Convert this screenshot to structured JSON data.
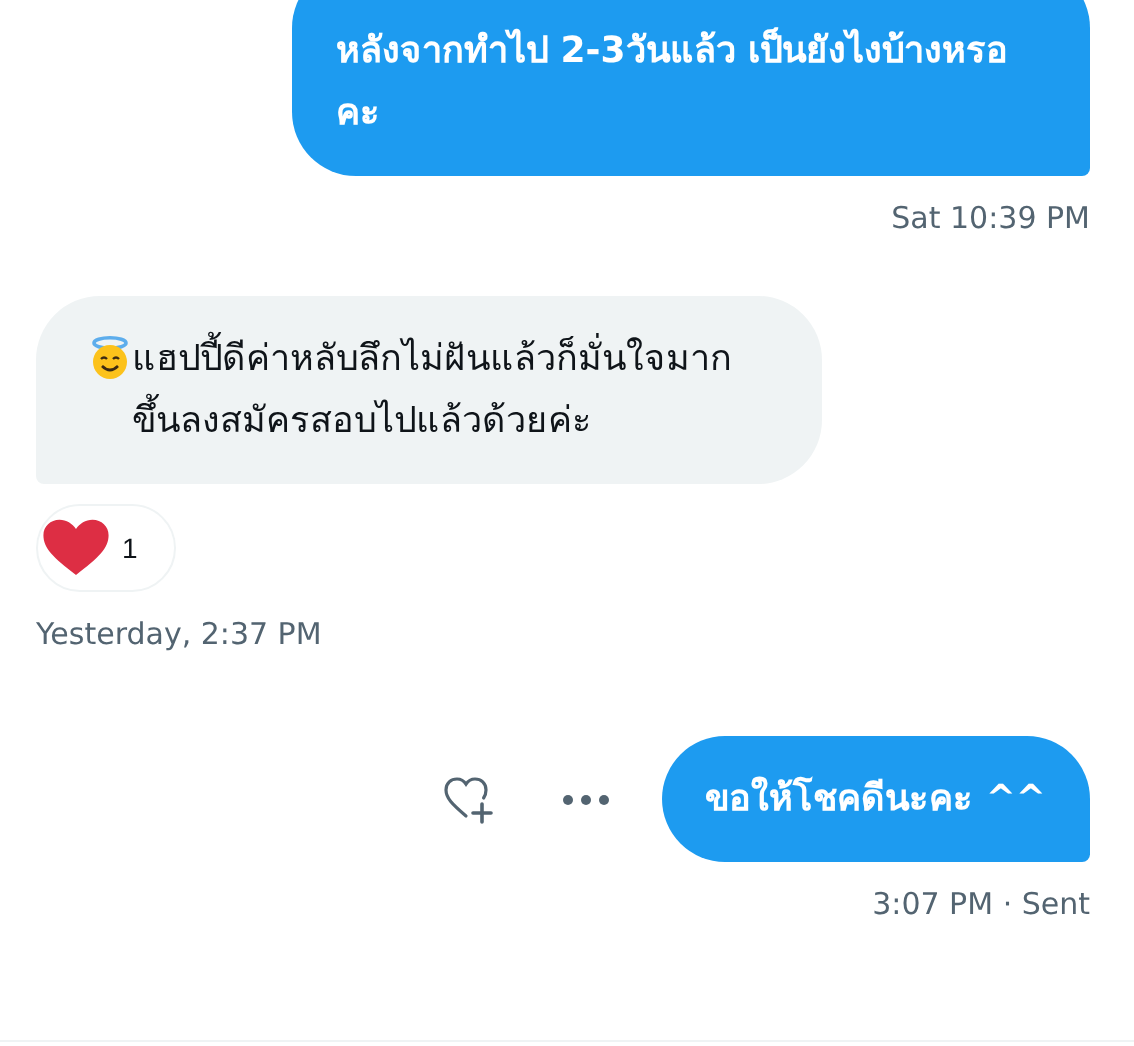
{
  "messages": [
    {
      "kind": "sent",
      "text": "หลังจากทำไป 2-3วันแล้ว เป็นยังไงบ้างหรอคะ",
      "timestamp": "Sat 10:39 PM",
      "cut_top": true
    },
    {
      "kind": "received",
      "icons": [
        {
          "kind": "halo_smile"
        }
      ],
      "text": "แฮปปี้ดีค่าหลับลึกไม่ฝันแล้วก็มั่นใจมากขึ้นลงสมัครสอบไปแล้วด้วยค่ะ",
      "reactions": [
        {
          "kind": "heart",
          "count": "1"
        }
      ],
      "timestamp": "Yesterday, 2:37 PM"
    },
    {
      "kind": "sent",
      "text": "ขอให้โชคดีนะคะ ^^",
      "timestamp": "3:07 PM · Sent",
      "actions": [
        {
          "kind": "react"
        },
        {
          "kind": "more"
        }
      ]
    }
  ]
}
